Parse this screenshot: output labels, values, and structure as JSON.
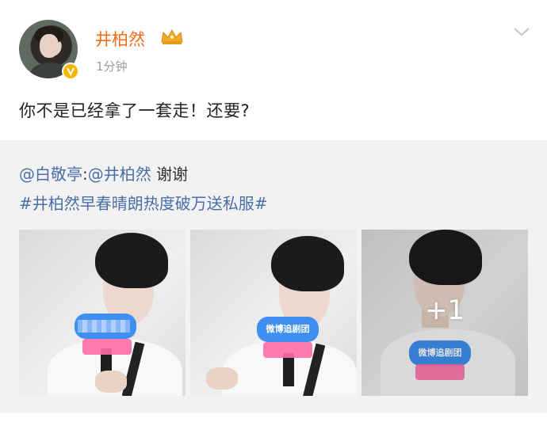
{
  "post": {
    "username": "井柏然",
    "time": "1分钟",
    "text": "你不是已经拿了一套走！还要?",
    "crown_icon": "crown-icon",
    "verify_icon": "verified-badge-icon"
  },
  "repost": {
    "mention_user": "@白敬亭",
    "separator": ":",
    "mention_target": "@井柏然",
    "reply_text": "谢谢",
    "hashtag": "#井柏然早春晴朗热度破万送私服#",
    "mic_label_1": "",
    "mic_label_2": "微博追剧团",
    "mic_label_3": "微博追剧团",
    "more_photos": "+1"
  },
  "colors": {
    "username": "#f56b18",
    "link": "#4a6fa5",
    "repost_bg": "#f2f2f2"
  }
}
